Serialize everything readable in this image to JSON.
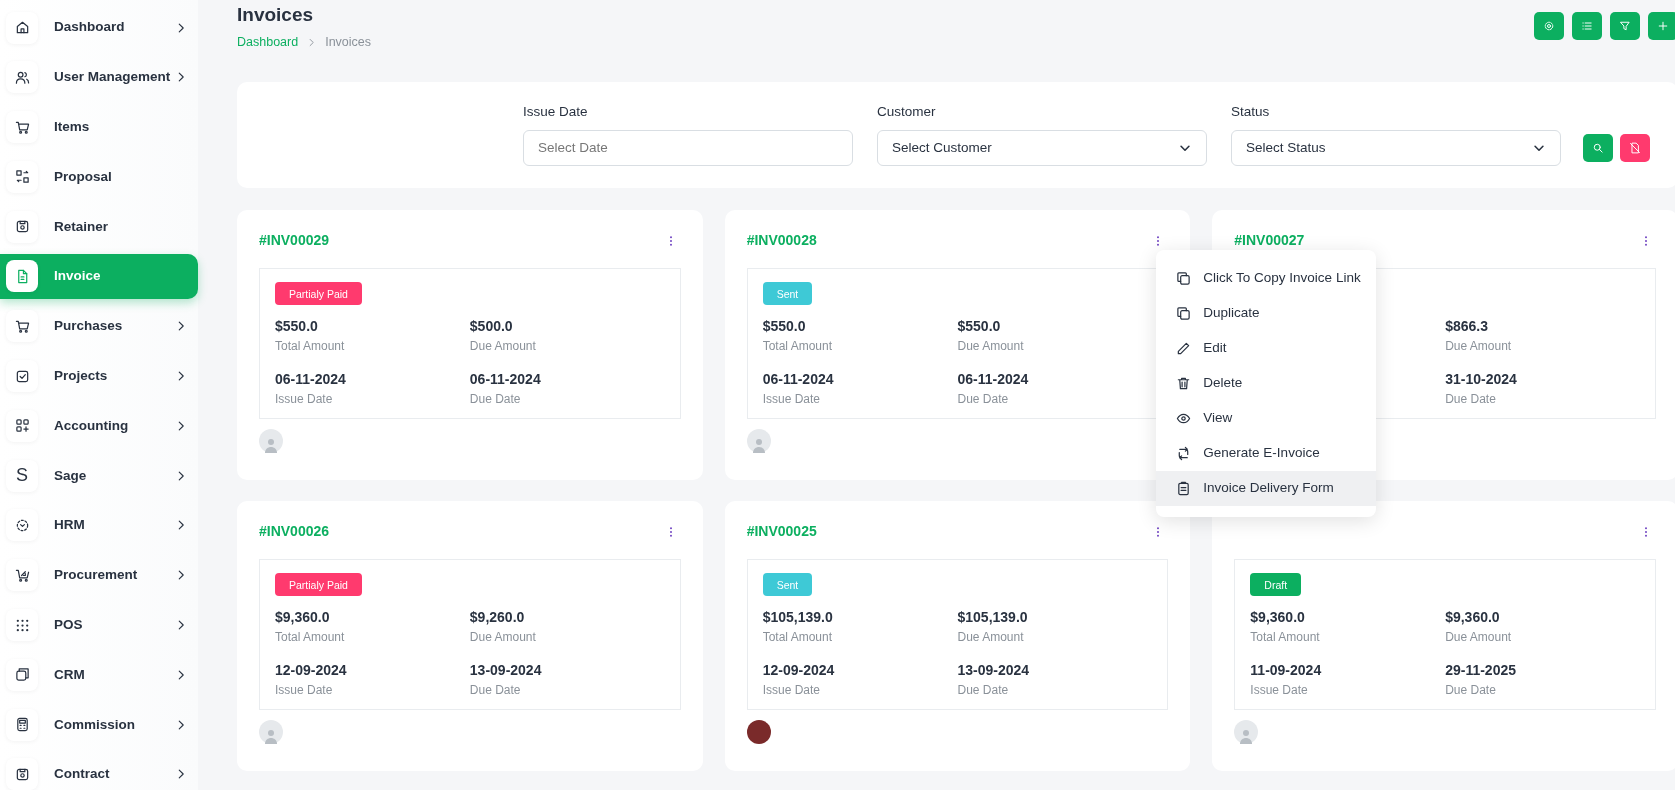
{
  "sidebar": {
    "items": [
      {
        "label": "Dashboard",
        "expandable": true,
        "selected": false
      },
      {
        "label": "User Management",
        "expandable": true,
        "selected": false
      },
      {
        "label": "Items",
        "expandable": false,
        "selected": false
      },
      {
        "label": "Proposal",
        "expandable": false,
        "selected": false
      },
      {
        "label": "Retainer",
        "expandable": false,
        "selected": false
      },
      {
        "label": "Invoice",
        "expandable": false,
        "selected": true
      },
      {
        "label": "Purchases",
        "expandable": true,
        "selected": false
      },
      {
        "label": "Projects",
        "expandable": true,
        "selected": false
      },
      {
        "label": "Accounting",
        "expandable": true,
        "selected": false
      },
      {
        "label": "Sage",
        "expandable": true,
        "selected": false,
        "icon_text": "S"
      },
      {
        "label": "HRM",
        "expandable": true,
        "selected": false
      },
      {
        "label": "Procurement",
        "expandable": true,
        "selected": false
      },
      {
        "label": "POS",
        "expandable": true,
        "selected": false
      },
      {
        "label": "CRM",
        "expandable": true,
        "selected": false
      },
      {
        "label": "Commission",
        "expandable": true,
        "selected": false
      },
      {
        "label": "Contract",
        "expandable": true,
        "selected": false
      }
    ]
  },
  "page": {
    "title": "Invoices",
    "breadcrumb": [
      {
        "label": "Dashboard",
        "link": true
      },
      {
        "label": "Invoices",
        "link": false
      }
    ]
  },
  "filters": [
    {
      "label": "Issue Date",
      "kind": "input",
      "placeholder": "Select Date"
    },
    {
      "label": "Customer",
      "kind": "select",
      "value": "Select Customer"
    },
    {
      "label": "Status",
      "kind": "select",
      "value": "Select Status"
    }
  ],
  "invoices": [
    {
      "number": "#INV00029",
      "status": {
        "label": "Partialy Paid",
        "color": "#ff3a6e"
      },
      "total": {
        "value": "$550.0",
        "label": "Total Amount"
      },
      "due": {
        "value": "$500.0",
        "label": "Due Amount"
      },
      "issue_date": {
        "value": "06-11-2024",
        "label": "Issue Date"
      },
      "due_date": {
        "value": "06-11-2024",
        "label": "Due Date"
      },
      "avatar_photo": false
    },
    {
      "number": "#INV00028",
      "status": {
        "label": "Sent",
        "color": "#3ec9d6"
      },
      "total": {
        "value": "$550.0",
        "label": "Total Amount"
      },
      "due": {
        "value": "$550.0",
        "label": "Due Amount"
      },
      "issue_date": {
        "value": "06-11-2024",
        "label": "Issue Date"
      },
      "due_date": {
        "value": "06-11-2024",
        "label": "Due Date"
      },
      "avatar_photo": false,
      "menu": [
        {
          "label": "Click To Copy Invoice Link",
          "hovered": false
        },
        {
          "label": "Duplicate",
          "hovered": false
        },
        {
          "label": "Edit",
          "hovered": false
        },
        {
          "label": "Delete",
          "hovered": false
        },
        {
          "label": "View",
          "hovered": false
        },
        {
          "label": "Generate E-Invoice",
          "hovered": false
        },
        {
          "label": "Invoice Delivery Form",
          "hovered": true
        }
      ]
    },
    {
      "number": "#INV00027",
      "due": {
        "value": "$866.3",
        "label": "Due Amount"
      },
      "due_date": {
        "value": "31-10-2024",
        "label": "Due Date"
      }
    },
    {
      "number": "#INV00026",
      "status": {
        "label": "Partialy Paid",
        "color": "#ff3a6e"
      },
      "total": {
        "value": "$9,360.0",
        "label": "Total Amount"
      },
      "due": {
        "value": "$9,260.0",
        "label": "Due Amount"
      },
      "issue_date": {
        "value": "12-09-2024",
        "label": "Issue Date"
      },
      "due_date": {
        "value": "13-09-2024",
        "label": "Due Date"
      },
      "avatar_photo": false
    },
    {
      "number": "#INV00025",
      "status": {
        "label": "Sent",
        "color": "#3ec9d6"
      },
      "total": {
        "value": "$105,139.0",
        "label": "Total Amount"
      },
      "due": {
        "value": "$105,139.0",
        "label": "Due Amount"
      },
      "issue_date": {
        "value": "12-09-2024",
        "label": "Issue Date"
      },
      "due_date": {
        "value": "13-09-2024",
        "label": "Due Date"
      },
      "avatar_photo": true
    },
    {
      "status": {
        "label": "Draft",
        "color": "#0caf60"
      },
      "total": {
        "value": "$9,360.0",
        "label": "Total Amount"
      },
      "due": {
        "value": "$9,360.0",
        "label": "Due Amount"
      },
      "issue_date": {
        "value": "11-09-2024",
        "label": "Issue Date"
      },
      "due_date": {
        "value": "29-11-2025",
        "label": "Due Date"
      },
      "avatar_photo": false
    }
  ]
}
